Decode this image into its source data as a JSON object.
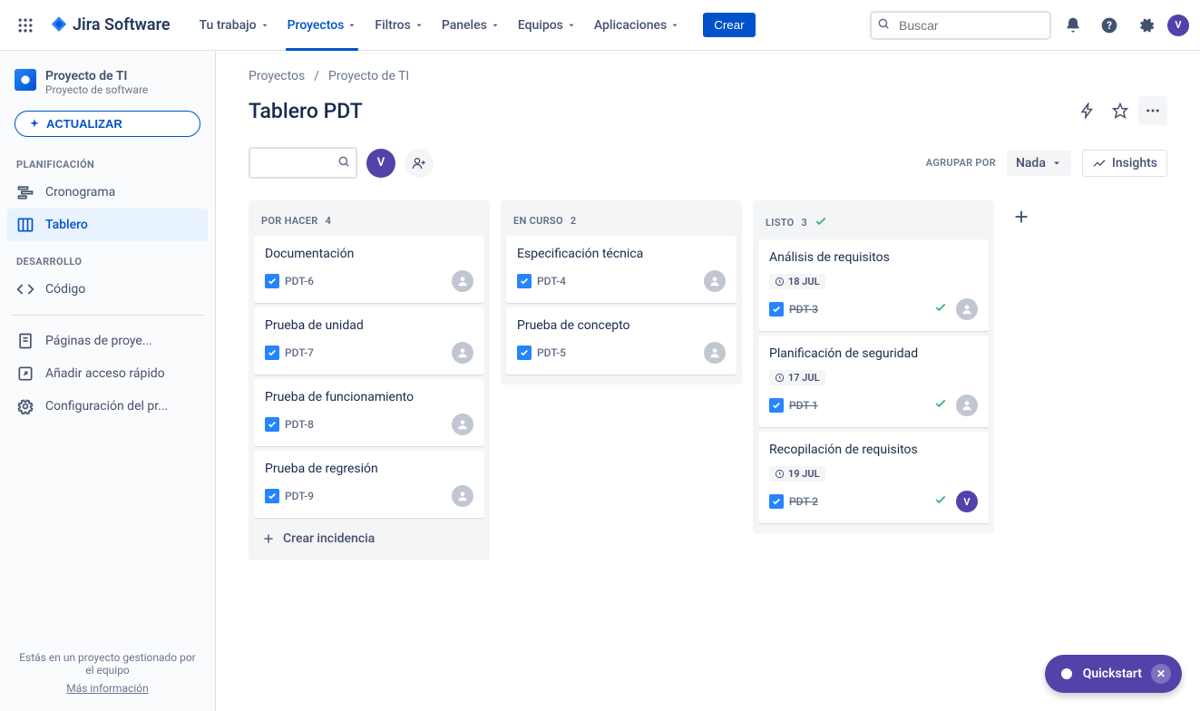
{
  "topnav": {
    "logo_text": "Jira Software",
    "items": [
      "Tu trabajo",
      "Proyectos",
      "Filtros",
      "Paneles",
      "Equipos",
      "Aplicaciones"
    ],
    "active_index": 1,
    "create_label": "Crear",
    "search_placeholder": "Buscar",
    "avatar_initial": "V"
  },
  "sidebar": {
    "project_name": "Proyecto de TI",
    "project_sub": "Proyecto de software",
    "upgrade_label": "ACTUALIZAR",
    "section_plan": "PLANIFICACIÓN",
    "item_timeline": "Cronograma",
    "item_board": "Tablero",
    "section_dev": "DESARROLLO",
    "item_code": "Código",
    "item_pages": "Páginas de proye...",
    "item_shortcut": "Añadir acceso rápido",
    "item_settings": "Configuración del pr...",
    "footer_text": "Estás en un proyecto gestionado por el equipo",
    "footer_link": "Más información"
  },
  "breadcrumb": {
    "root": "Proyectos",
    "current": "Proyecto de TI"
  },
  "page": {
    "title": "Tablero PDT"
  },
  "toolbar": {
    "avatar_initial": "V",
    "group_by_label": "AGRUPAR POR",
    "group_by_value": "Nada",
    "insights_label": "Insights"
  },
  "columns": [
    {
      "title": "POR HACER",
      "count": "4",
      "done": false,
      "cards": [
        {
          "title": "Documentación",
          "key": "PDT-6",
          "done": false,
          "assignee": "none"
        },
        {
          "title": "Prueba de unidad",
          "key": "PDT-7",
          "done": false,
          "assignee": "none"
        },
        {
          "title": "Prueba de funcionamiento",
          "key": "PDT-8",
          "done": false,
          "assignee": "none"
        },
        {
          "title": "Prueba de regresión",
          "key": "PDT-9",
          "done": false,
          "assignee": "none"
        }
      ],
      "create_label": "Crear incidencia"
    },
    {
      "title": "EN CURSO",
      "count": "2",
      "done": false,
      "cards": [
        {
          "title": "Especificación técnica",
          "key": "PDT-4",
          "done": false,
          "assignee": "none"
        },
        {
          "title": "Prueba de concepto",
          "key": "PDT-5",
          "done": false,
          "assignee": "none"
        }
      ]
    },
    {
      "title": "LISTO",
      "count": "3",
      "done": true,
      "cards": [
        {
          "title": "Análisis de requisitos",
          "key": "PDT-3",
          "done": true,
          "date": "18 JUL",
          "assignee": "none"
        },
        {
          "title": "Planificación de seguridad",
          "key": "PDT-1",
          "done": true,
          "date": "17 JUL",
          "assignee": "none"
        },
        {
          "title": "Recopilación de requisitos",
          "key": "PDT-2",
          "done": true,
          "date": "19 JUL",
          "assignee": "V"
        }
      ]
    }
  ],
  "quickstart": {
    "label": "Quickstart"
  }
}
